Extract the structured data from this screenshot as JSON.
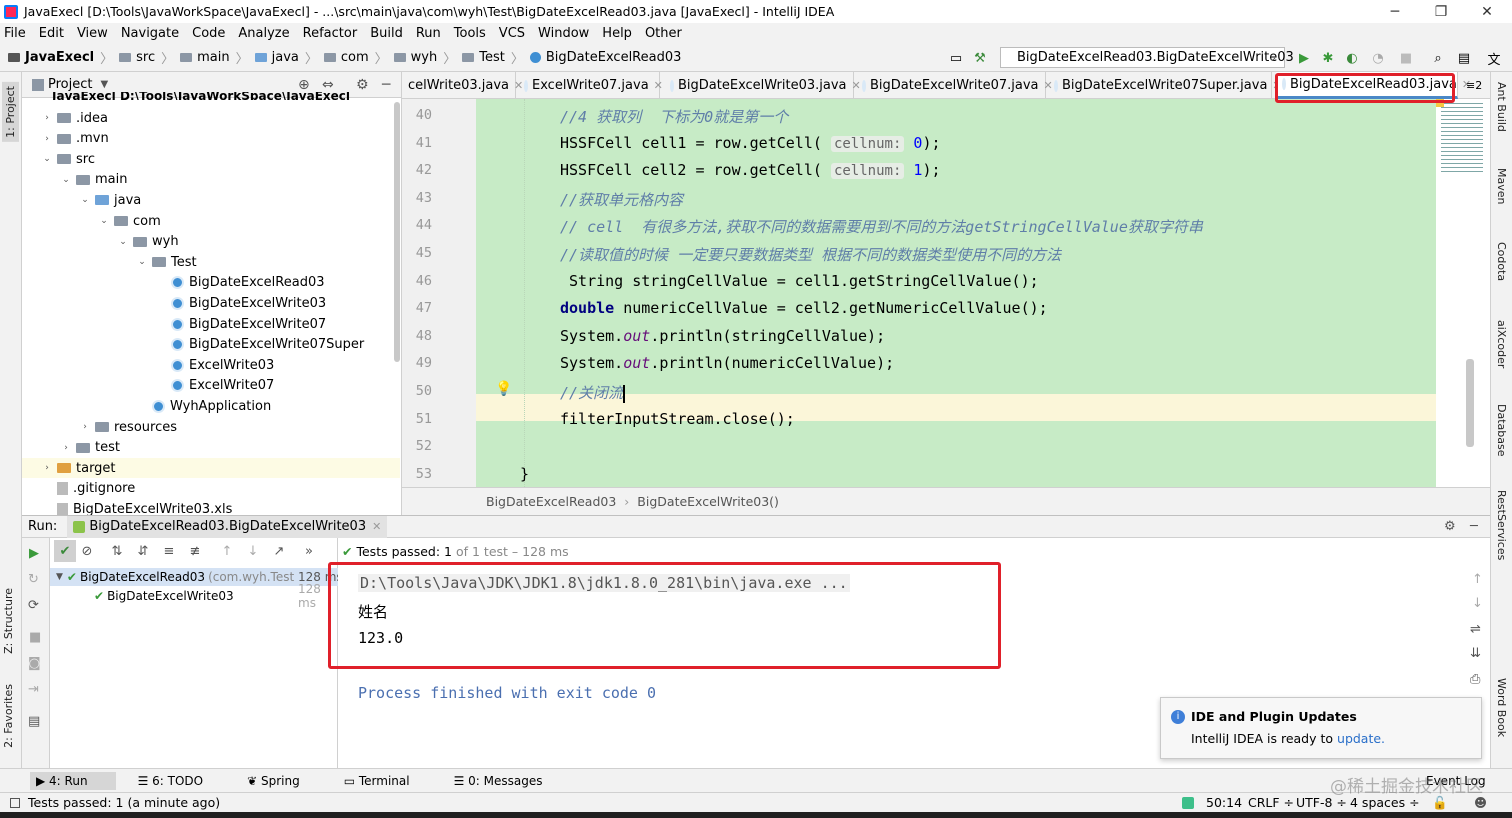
{
  "window": {
    "title": "JavaExecl [D:\\Tools\\JavaWorkSpace\\JavaExecl] - ...\\src\\main\\java\\com\\wyh\\Test\\BigDateExcelRead03.java [JavaExecl] - IntelliJ IDEA",
    "minimize": "─",
    "maximize": "❐",
    "close": "✕"
  },
  "menu": [
    "File",
    "Edit",
    "View",
    "Navigate",
    "Code",
    "Analyze",
    "Refactor",
    "Build",
    "Run",
    "Tools",
    "VCS",
    "Window",
    "Help",
    "Other"
  ],
  "breadcrumb": [
    "JavaExecl",
    "src",
    "main",
    "java",
    "com",
    "wyh",
    "Test",
    "BigDateExcelRead03"
  ],
  "run_config": "BigDateExcelRead03.BigDateExcelWrite03",
  "left_strip": {
    "project": "1: Project",
    "structure": "Z: Structure",
    "favorites": "2: Favorites"
  },
  "right_strip": {
    "ant": "Ant Build",
    "maven": "Maven",
    "codota": "Codota",
    "aixcoder": "aiXcoder",
    "database": "Database",
    "rest": "RestServices",
    "wordbook": "Word Book"
  },
  "project": {
    "header": "Project",
    "root_cut": "JavaExecl  D:\\Tools\\JavaWorkSpace\\JavaExecl",
    "tree": [
      {
        "label": ".idea",
        "depth": 1,
        "arrow": "›",
        "kind": "folder"
      },
      {
        "label": ".mvn",
        "depth": 1,
        "arrow": "›",
        "kind": "folder"
      },
      {
        "label": "src",
        "depth": 1,
        "arrow": "⌄",
        "kind": "folder"
      },
      {
        "label": "main",
        "depth": 2,
        "arrow": "⌄",
        "kind": "folder"
      },
      {
        "label": "java",
        "depth": 3,
        "arrow": "⌄",
        "kind": "folder-blue"
      },
      {
        "label": "com",
        "depth": 4,
        "arrow": "⌄",
        "kind": "folder"
      },
      {
        "label": "wyh",
        "depth": 5,
        "arrow": "⌄",
        "kind": "folder"
      },
      {
        "label": "Test",
        "depth": 6,
        "arrow": "⌄",
        "kind": "folder"
      },
      {
        "label": "BigDateExcelRead03",
        "depth": 7,
        "arrow": "",
        "kind": "class"
      },
      {
        "label": "BigDateExcelWrite03",
        "depth": 7,
        "arrow": "",
        "kind": "class"
      },
      {
        "label": "BigDateExcelWrite07",
        "depth": 7,
        "arrow": "",
        "kind": "class"
      },
      {
        "label": "BigDateExcelWrite07Super",
        "depth": 7,
        "arrow": "",
        "kind": "class"
      },
      {
        "label": "ExcelWrite03",
        "depth": 7,
        "arrow": "",
        "kind": "class"
      },
      {
        "label": "ExcelWrite07",
        "depth": 7,
        "arrow": "",
        "kind": "class"
      },
      {
        "label": "WyhApplication",
        "depth": 6,
        "arrow": "",
        "kind": "class"
      },
      {
        "label": "resources",
        "depth": 3,
        "arrow": "›",
        "kind": "folder"
      },
      {
        "label": "test",
        "depth": 2,
        "arrow": "›",
        "kind": "folder"
      },
      {
        "label": "target",
        "depth": 1,
        "arrow": "›",
        "kind": "folder-orange"
      },
      {
        "label": ".gitignore",
        "depth": 1,
        "arrow": "",
        "kind": "file"
      },
      {
        "label": "BigDateExcelWrite03.xls",
        "depth": 1,
        "arrow": "",
        "kind": "file"
      }
    ]
  },
  "tabs": [
    {
      "label": "celWrite03.java"
    },
    {
      "label": "ExcelWrite07.java"
    },
    {
      "label": "BigDateExcelWrite03.java"
    },
    {
      "label": "BigDateExcelWrite07.java"
    },
    {
      "label": "BigDateExcelWrite07Super.java"
    },
    {
      "label": "BigDateExcelRead03.java",
      "active": true
    }
  ],
  "tabs_more": "≡2",
  "code": {
    "lines": [
      {
        "n": "40",
        "html": "<span class='cmt'>//4 获取列  下标为0就是第一个</span>"
      },
      {
        "n": "41",
        "html": "HSSFCell cell1 = row.getCell( <span class='hint'>cellnum:</span> <span class='num'>0</span>);"
      },
      {
        "n": "42",
        "html": "HSSFCell cell2 = row.getCell( <span class='hint'>cellnum:</span> <span class='num'>1</span>);"
      },
      {
        "n": "43",
        "html": "<span class='cmt'>//获取单元格内容</span>"
      },
      {
        "n": "44",
        "html": "<span class='cmt'>// cell  有很多方法,获取不同的数据需要用到不同的方法getStringCellValue获取字符串</span>"
      },
      {
        "n": "45",
        "html": "<span class='cmt'>//读取值的时候 一定要只要数据类型 根据不同的数据类型使用不同的方法</span>"
      },
      {
        "n": "46",
        "html": " String stringCellValue = cell1.getStringCellValue();"
      },
      {
        "n": "47",
        "html": "<span class='kw'>double</span> numericCellValue = cell2.getNumericCellValue();"
      },
      {
        "n": "48",
        "html": "System.<span class='fld'>out</span>.println(stringCellValue);"
      },
      {
        "n": "49",
        "html": "System.<span class='fld'>out</span>.println(numericCellValue);"
      },
      {
        "n": "50",
        "html": "<span class='cmt'>//关闭流</span>"
      },
      {
        "n": "51",
        "html": "filterInputStream.close();"
      },
      {
        "n": "52",
        "html": ""
      },
      {
        "n": "53",
        "html": "}"
      }
    ]
  },
  "editor_breadcrumb": [
    "BigDateExcelRead03",
    "BigDateExcelWrite03()"
  ],
  "run": {
    "label": "Run:",
    "tab": "BigDateExcelRead03.BigDateExcelWrite03",
    "passed_label": "Tests passed:",
    "passed_count": "1",
    "passed_rest": "of 1 test – 128 ms",
    "tree": [
      {
        "label": "BigDateExcelRead03",
        "sub": "(com.wyh.Test",
        "time": "128 ms"
      },
      {
        "label": "BigDateExcelWrite03",
        "sub": "",
        "time": "128 ms"
      }
    ],
    "console": [
      "D:\\Tools\\Java\\JDK\\JDK1.8\\jdk1.8.0_281\\bin\\java.exe ...",
      "姓名",
      "123.0",
      "",
      "Process finished with exit code 0"
    ]
  },
  "notification": {
    "title": "IDE and Plugin Updates",
    "text": "IntelliJ IDEA is ready to ",
    "link": "update."
  },
  "bottom_tabs": [
    "4: Run",
    "6: TODO",
    "Spring",
    "Terminal",
    "0: Messages"
  ],
  "event_log": "Event Log",
  "status": {
    "left": "Tests passed: 1 (a minute ago)",
    "pos": "50:14",
    "crlf": "CRLF ÷",
    "enc": "UTF-8 ÷",
    "indent": "4 spaces ÷"
  },
  "watermark": "@稀土掘金技术社区",
  "colors": {
    "code_bg": "#c7ebc6",
    "highlight_box": "#e0202a",
    "caret_line": "#fbf6d9"
  }
}
